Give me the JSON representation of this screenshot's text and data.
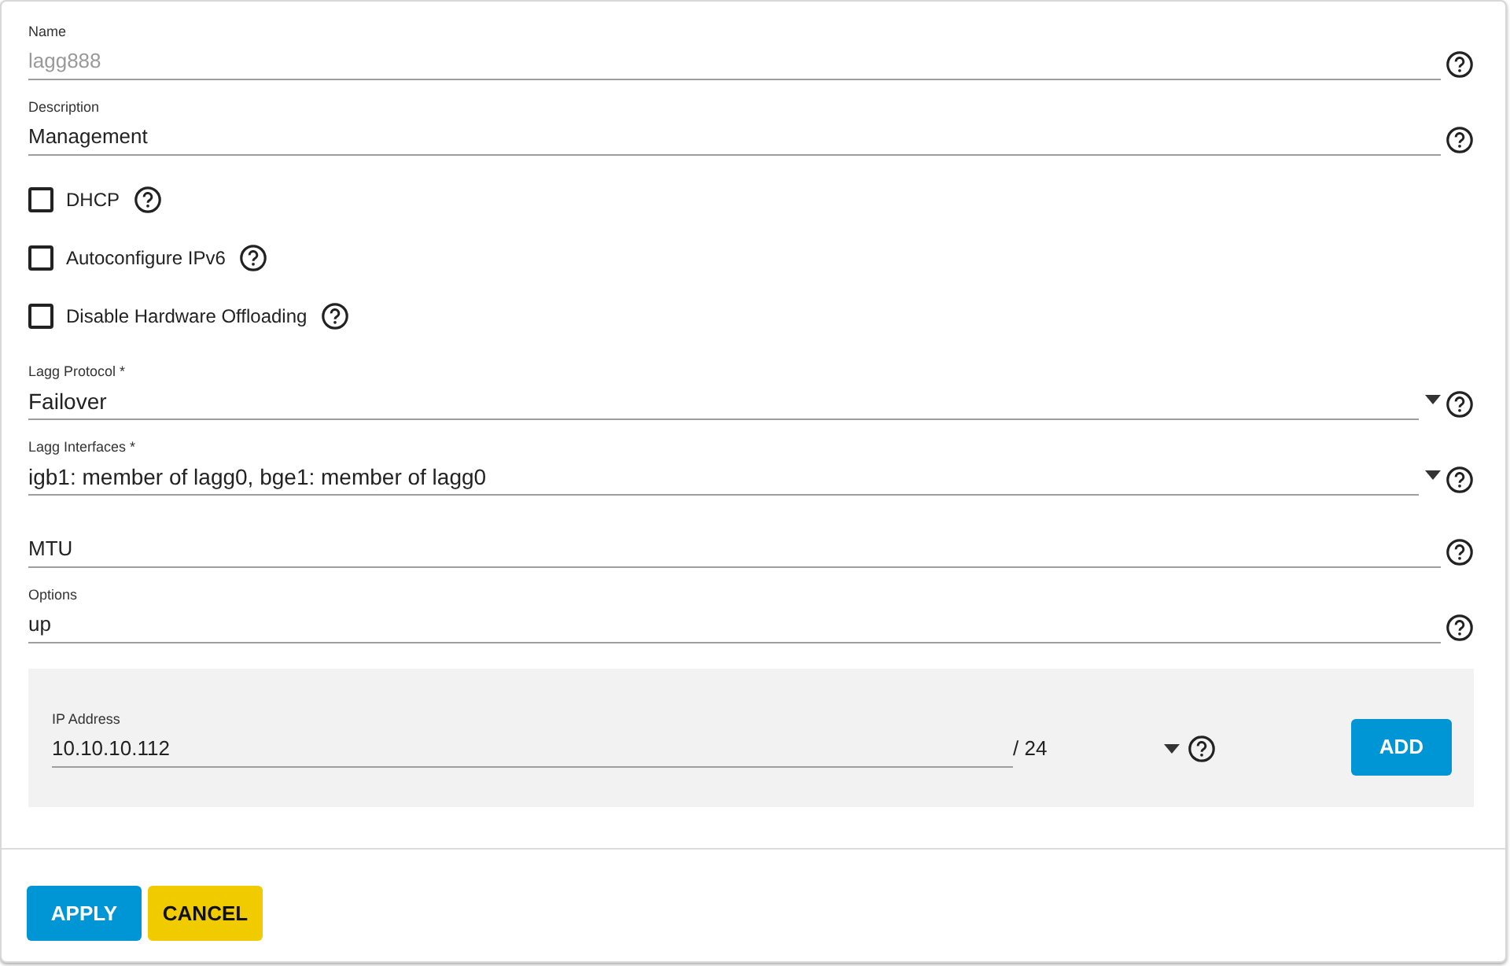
{
  "fields": [
    {
      "kind": "text",
      "label": "Name",
      "value": "lagg888",
      "disabled": true
    },
    {
      "kind": "text",
      "label": "Description",
      "value": "Management",
      "disabled": false
    },
    {
      "kind": "checkbox",
      "label": "DHCP",
      "checked": false
    },
    {
      "kind": "checkbox",
      "label": "Autoconfigure IPv6",
      "checked": false
    },
    {
      "kind": "checkbox",
      "label": "Disable Hardware Offloading",
      "checked": false
    },
    {
      "kind": "select",
      "label": "Lagg Protocol *",
      "value": "Failover"
    },
    {
      "kind": "select",
      "label": "Lagg Interfaces *",
      "value": "igb1: member of lagg0, bge1: member of lagg0"
    },
    {
      "kind": "text",
      "placeholder": "MTU",
      "disabled": false
    },
    {
      "kind": "text",
      "label": "Options",
      "value": "up",
      "disabled": false
    }
  ],
  "ip_address": {
    "label": "IP Address",
    "value": "10.10.10.112",
    "netmask": "/ 24",
    "add_button": "ADD"
  },
  "buttons": [
    {
      "label": "APPLY",
      "kind": "primary"
    },
    {
      "label": "CANCEL",
      "kind": "warning"
    }
  ]
}
